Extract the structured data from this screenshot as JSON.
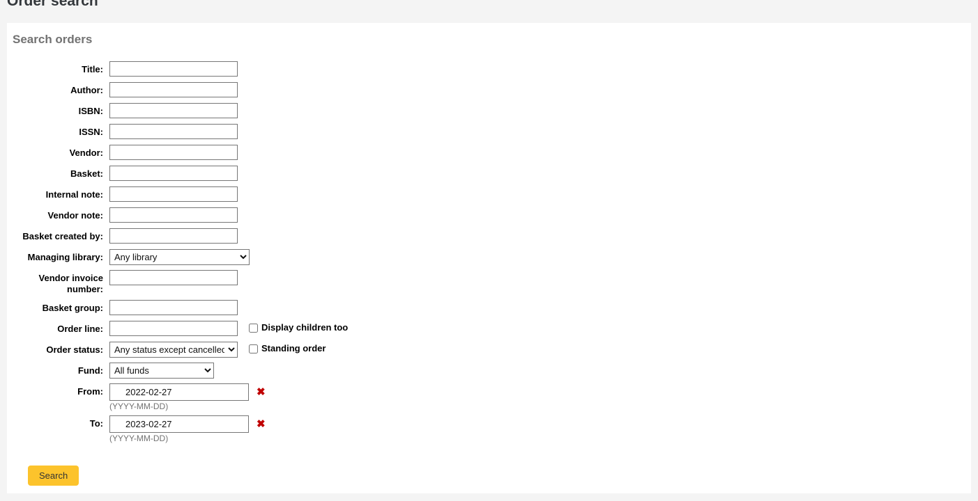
{
  "page": {
    "title": "Order search",
    "card_heading": "Search orders"
  },
  "form": {
    "fields": [
      {
        "label": "Title:",
        "name": "title",
        "value": ""
      },
      {
        "label": "Author:",
        "name": "author",
        "value": ""
      },
      {
        "label": "ISBN:",
        "name": "isbn",
        "value": ""
      },
      {
        "label": "ISSN:",
        "name": "issn",
        "value": ""
      },
      {
        "label": "Vendor:",
        "name": "vendor",
        "value": ""
      },
      {
        "label": "Basket:",
        "name": "basket",
        "value": ""
      },
      {
        "label": "Internal note:",
        "name": "internal-note",
        "value": ""
      },
      {
        "label": "Vendor note:",
        "name": "vendor-note",
        "value": ""
      },
      {
        "label": "Basket created by:",
        "name": "basket-created-by",
        "value": ""
      }
    ],
    "managing_library": {
      "label": "Managing library:",
      "selected": "Any library",
      "options": [
        "Any library"
      ]
    },
    "vendor_invoice_number": {
      "label": "Vendor invoice number:",
      "value": ""
    },
    "basket_group": {
      "label": "Basket group:",
      "value": ""
    },
    "order_line": {
      "label": "Order line:",
      "value": ""
    },
    "display_children": {
      "label": "Display children too",
      "checked": false
    },
    "order_status": {
      "label": "Order status:",
      "selected": "Any status except cancelled",
      "options": [
        "Any status except cancelled"
      ]
    },
    "standing_order": {
      "label": "Standing order",
      "checked": false
    },
    "fund": {
      "label": "Fund:",
      "selected": "All funds",
      "options": [
        "All funds"
      ]
    },
    "date_from": {
      "label": "From:",
      "value": "2022-02-27",
      "hint": "(YYYY-MM-DD)",
      "clear_icon": "✖"
    },
    "date_to": {
      "label": "To:",
      "value": "2023-02-27",
      "hint": "(YYYY-MM-DD)",
      "clear_icon": "✖"
    },
    "submit_label": "Search"
  },
  "colors": {
    "accent_button": "#fcc32c",
    "clear_icon": "#c00000",
    "heading": "#727272",
    "page_bg": "#f4f4f4"
  }
}
